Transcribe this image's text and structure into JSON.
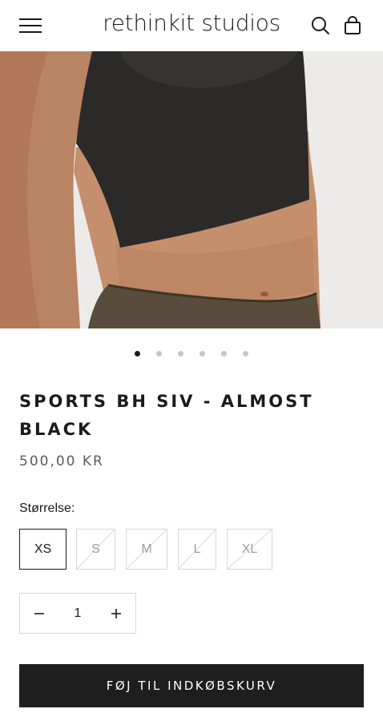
{
  "header": {
    "logo_text": "rethinkit studios",
    "menu_icon": "hamburger-menu-icon",
    "search_icon": "search-icon",
    "cart_icon": "shopping-bag-icon"
  },
  "gallery": {
    "image": "product photo: model wearing dark sports bra top",
    "slide_count": 6,
    "active_slide": 1
  },
  "product": {
    "title": "SPORTS BH SIV - ALMOST BLACK",
    "price": "500,00 KR",
    "size_label": "Størrelse:",
    "sizes": [
      {
        "label": "XS",
        "available": true,
        "selected": true
      },
      {
        "label": "S",
        "available": false,
        "selected": false
      },
      {
        "label": "M",
        "available": false,
        "selected": false
      },
      {
        "label": "L",
        "available": false,
        "selected": false
      },
      {
        "label": "XL",
        "available": false,
        "selected": false
      }
    ],
    "quantity": "1",
    "add_to_cart_label": "FØJ TIL INDKØBSKURV"
  },
  "colors": {
    "text": "#1c1b1b",
    "muted": "#5c5c5c",
    "border": "#d7d7d7",
    "button_bg": "#1e1e1e",
    "button_text": "#ffffff",
    "dot_inactive": "#c7c7c7"
  }
}
